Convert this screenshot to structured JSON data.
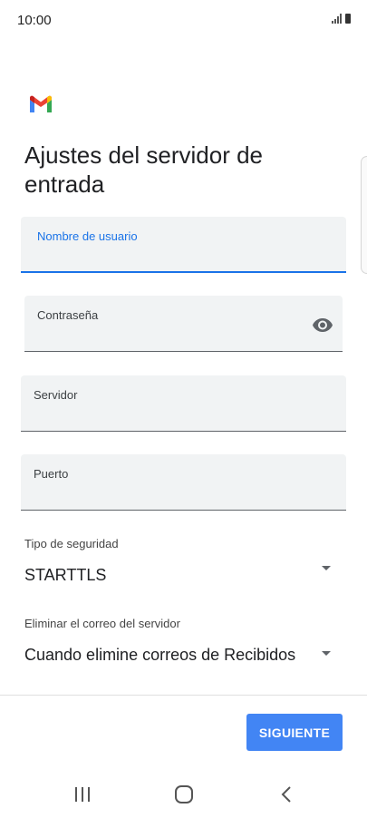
{
  "status_bar": {
    "time": "10:00",
    "icons": [
      "signal-icon",
      "battery-icon"
    ]
  },
  "app": {
    "logo": "gmail-logo"
  },
  "page": {
    "title": "Ajustes del servidor de entrada"
  },
  "fields": {
    "username": {
      "label": "Nombre de usuario",
      "value": ""
    },
    "password": {
      "label": "Contraseña",
      "value": "",
      "icon": "eye-icon"
    },
    "server": {
      "label": "Servidor",
      "value": ""
    },
    "port": {
      "label": "Puerto",
      "value": ""
    }
  },
  "security_type": {
    "label": "Tipo de seguridad",
    "value": "STARTTLS"
  },
  "delete_mail": {
    "label": "Eliminar el correo del servidor",
    "value": "Cuando elimine correos de Recibidos"
  },
  "actions": {
    "next_label": "SIGUIENTE"
  },
  "nav": {
    "items": [
      "recents-icon",
      "home-icon",
      "back-icon"
    ]
  },
  "colors": {
    "accent": "#1a73e8",
    "button": "#4285f4",
    "field_bg": "#f1f3f4"
  }
}
